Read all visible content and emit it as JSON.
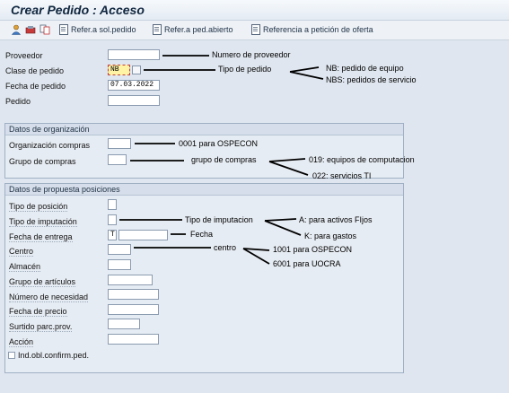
{
  "window": {
    "title": "Crear Pedido : Acceso"
  },
  "toolbar": {
    "btn1": "Refer.a sol.pedido",
    "btn2": "Refer.a ped.abierto",
    "btn3": "Referencia a petición de oferta"
  },
  "header": {
    "proveedor_label": "Proveedor",
    "clase_label": "Clase de pedido",
    "clase_value": "NB",
    "fecha_label": "Fecha de pedido",
    "fecha_value": "07.03.2022",
    "pedido_label": "Pedido"
  },
  "org": {
    "title": "Datos de organización",
    "orgcompras_label": "Organización compras",
    "grupo_label": "Grupo de compras"
  },
  "pos": {
    "title": "Datos de propuesta posiciones",
    "tipo_pos": "Tipo de posición",
    "tipo_imp": "Tipo de imputación",
    "fecha_entrega": "Fecha de entrega",
    "fecha_entrega_value": "T",
    "centro": "Centro",
    "almacen": "Almacén",
    "grupo_art": "Grupo de artículos",
    "num_nec": "Número de necesidad",
    "fecha_precio": "Fecha de precio",
    "surtido": "Surtido parc.prov.",
    "accion": "Acción",
    "ind": "Ind.obl.confirm.ped."
  },
  "annotations": {
    "a1": "Numero de proveedor",
    "a2": "Tipo de pedido",
    "a3": "NB: pedido de equipo",
    "a4": "NBS: pedidos de servicio",
    "a5": "0001 para OSPECON",
    "a6": "grupo de compras",
    "a7": "019: equipos de computacion",
    "a8": "022: servicios TI",
    "a9": "Tipo de imputacion",
    "a10": "A: para activos FIjos",
    "a11": "K: para gastos",
    "a12": "Fecha",
    "a13": "centro",
    "a14": "1001 para OSPECON",
    "a15": "6001 para UOCRA"
  }
}
